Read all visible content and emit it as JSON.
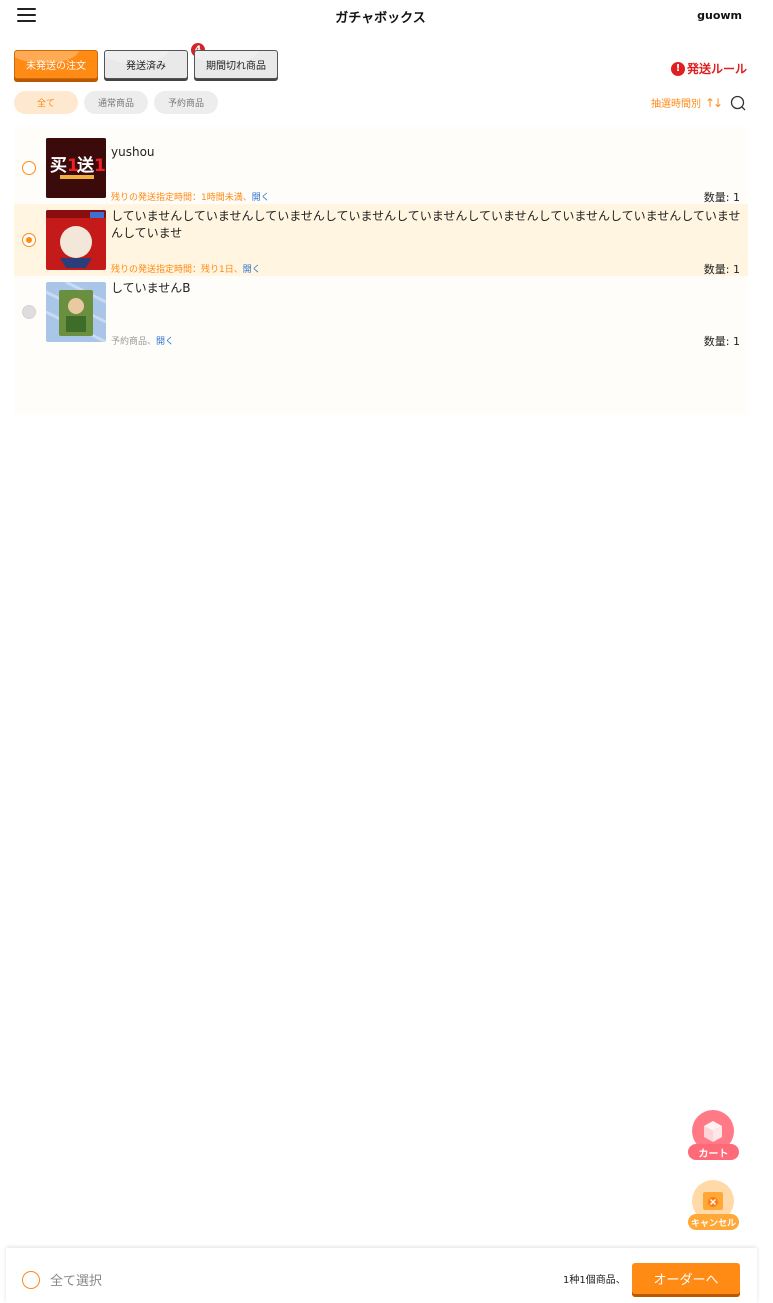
{
  "header": {
    "title": "ガチャボックス",
    "username": "guowm",
    "menu_icon": "menu-icon"
  },
  "tabs": [
    {
      "label": "未発送の注文",
      "active": true
    },
    {
      "label": "発送済み",
      "active": false,
      "badge": "4"
    },
    {
      "label": "期間切れ商品",
      "active": false
    }
  ],
  "rules": {
    "label": "発送ルール",
    "icon": "alert-icon"
  },
  "filters": [
    {
      "label": "全て",
      "active": true
    },
    {
      "label": "通常商品",
      "active": false
    },
    {
      "label": "予約商品",
      "active": false
    }
  ],
  "sort": {
    "label": "抽選時間別",
    "icon": "sort-icon"
  },
  "search": {
    "icon": "search-icon"
  },
  "items": [
    {
      "name": "yushou",
      "meta_prefix": "残りの発送指定時間：1時間未満、",
      "meta_link": "開く",
      "quantity": "数量: 1",
      "state": "unchecked",
      "meta_style": "warn"
    },
    {
      "name": "していませんしていませんしていませんしていませんしていませんしていませんしていませんしていませんしていませんしていませ",
      "meta_prefix": "残りの発送指定時間：残り1日、",
      "meta_link": "開く",
      "quantity": "数量: 1",
      "state": "checked",
      "meta_style": "warn"
    },
    {
      "name": "していませんB",
      "meta_prefix": "予約商品、",
      "meta_link": "開く",
      "quantity": "数量: 1",
      "state": "disabled",
      "meta_style": "muted"
    }
  ],
  "float_buttons": {
    "cart": {
      "label": "カート",
      "icon": "box-icon"
    },
    "cancel": {
      "label": "キャンセル",
      "icon": "cancel-box-icon"
    }
  },
  "footer": {
    "select_all": "全て選択",
    "summary": "1种1個商品、",
    "order_button": "オーダーへ"
  },
  "colors": {
    "accent": "#ff8a14",
    "alert": "#e02020",
    "link": "#2f74d0",
    "selected_row": "#fff5e1",
    "badge": "#d1252c"
  }
}
